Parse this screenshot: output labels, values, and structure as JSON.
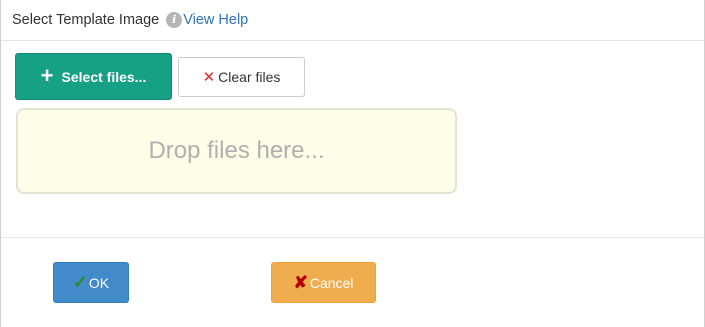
{
  "dialog": {
    "title": "Select Template Image",
    "help_icon": "info-icon",
    "help_link": "View Help"
  },
  "upload": {
    "select_button": {
      "icon": "plus-icon",
      "label": "Select files..."
    },
    "clear_button": {
      "icon": "close-icon",
      "label": "Clear files"
    },
    "dropzone_text": "Drop files here..."
  },
  "footer": {
    "ok_button": {
      "icon": "check-icon",
      "label": "OK"
    },
    "cancel_button": {
      "icon": "cancel-x-icon",
      "label": "Cancel"
    }
  },
  "colors": {
    "select_button": "#16a085",
    "ok_button": "#428bca",
    "cancel_button": "#f0ad4e",
    "dropzone": "#fdfde8",
    "link": "#3174b8"
  }
}
